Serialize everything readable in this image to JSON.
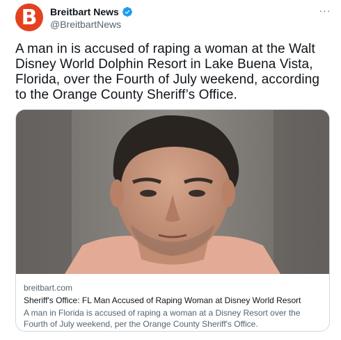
{
  "author": {
    "display_name": "Breitbart News",
    "handle": "@BreitbartNews",
    "avatar_letter": "B",
    "avatar_color": "#e4411f",
    "verified": true
  },
  "icons": {
    "verified": "verified-badge-icon",
    "more": "more-options-icon"
  },
  "more_label": "···",
  "tweet_text": "A man in is accused of raping a woman at the Walt Disney World Dolphin Resort in Lake Buena Vista, Florida, over the Fourth of July weekend, according to the Orange County Sheriff’s Office.",
  "link_card": {
    "domain": "breitbart.com",
    "title": "Sheriff's Office: FL Man Accused of Raping Woman at Disney World Resort",
    "description": "A man in Florida is accused of raping a woman at a Disney Resort over the Fourth of July weekend, per the Orange County Sheriff's Office."
  },
  "colors": {
    "text_primary": "#0f1419",
    "text_secondary": "#536471",
    "verified_blue": "#1d9bf0",
    "card_border": "#cfd9de"
  }
}
